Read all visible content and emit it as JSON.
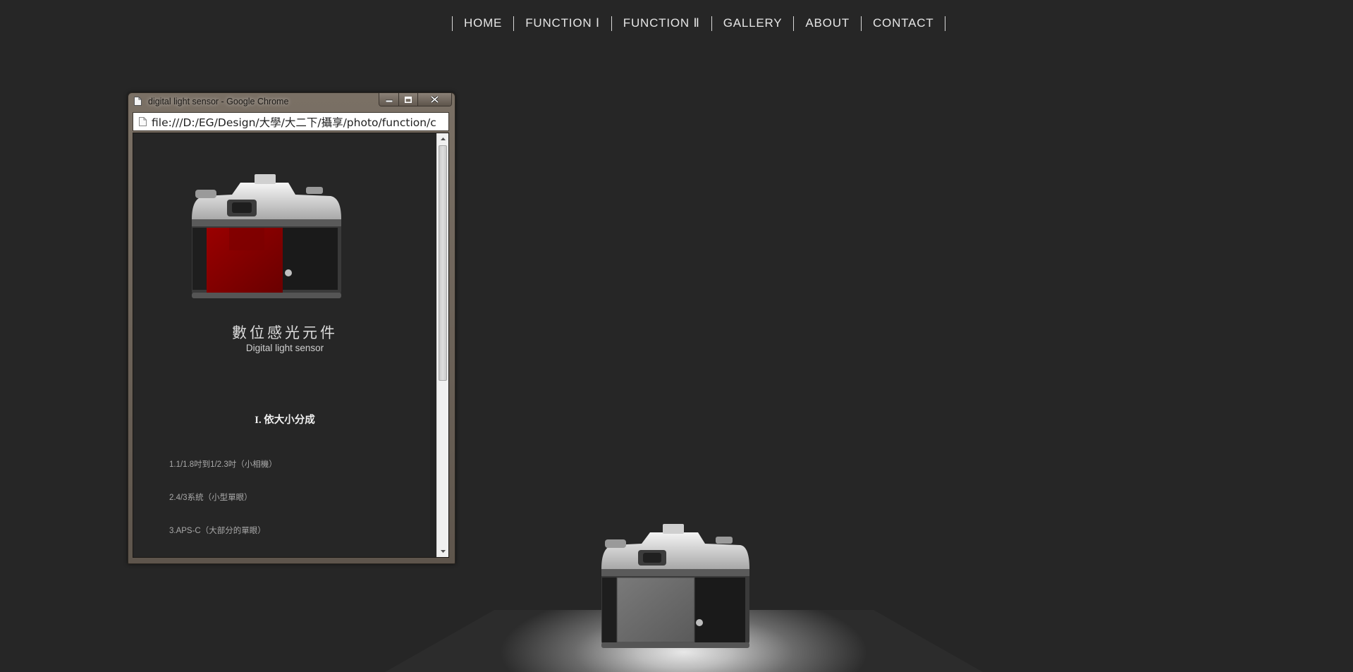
{
  "nav": {
    "items": [
      "HOME",
      "FUNCTION Ⅰ",
      "FUNCTION Ⅱ",
      "GALLERY",
      "ABOUT",
      "CONTACT"
    ]
  },
  "popup": {
    "window_title": "digital light sensor - Google Chrome",
    "address": "file:///D:/EG/Design/大學/大二下/攝享/photo/function/c",
    "heading_zh": "數位感光元件",
    "heading_en": "Digital light sensor",
    "section_title": "I. 依大小分成",
    "list": [
      "1.1/1.8吋到1/2.3吋（小相機）",
      "2.4/3系統（小型單眼）",
      "3.APS-C（大部分的單眼）"
    ],
    "scroll_position": 0.0
  },
  "colors": {
    "page_bg": "#262626",
    "nav_text": "#e6e6e6",
    "window_frame": "#6f665c",
    "sensor_highlight": "#8b0000"
  },
  "icons": {
    "title_icon": "page-icon",
    "address_icon": "page-icon",
    "minimize": "minimize-icon",
    "maximize": "maximize-icon",
    "close": "close-icon"
  }
}
